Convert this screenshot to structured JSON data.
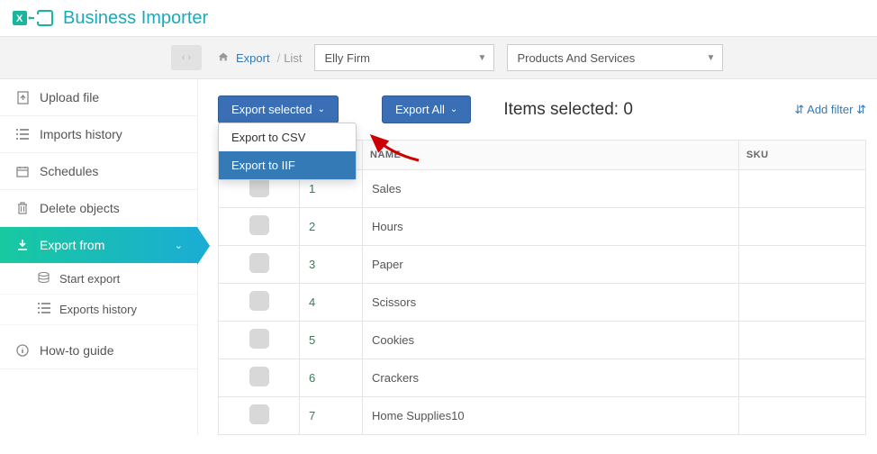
{
  "app": {
    "title": "Business Importer"
  },
  "toolbar": {
    "crumb_link": "Export",
    "crumb_current": "List",
    "select_firm": "Elly Firm",
    "select_entity": "Products And Services"
  },
  "sidebar": {
    "upload": "Upload file",
    "imports_history": "Imports history",
    "schedules": "Schedules",
    "delete_objects": "Delete objects",
    "export_from": "Export from",
    "start_export": "Start export",
    "exports_history": "Exports history",
    "howto": "How-to guide"
  },
  "actions": {
    "export_selected": "Export selected",
    "export_all": "Export All",
    "items_selected_label": "Items selected:",
    "items_selected_count": "0",
    "add_filter": "Add filter"
  },
  "dropdown": {
    "csv": "Export to CSV",
    "iif": "Export to IIF"
  },
  "table": {
    "headers": {
      "name": "NAME",
      "sku": "SKU"
    },
    "rows": [
      {
        "n": "1",
        "name": "Sales",
        "sku": ""
      },
      {
        "n": "2",
        "name": "Hours",
        "sku": ""
      },
      {
        "n": "3",
        "name": "Paper",
        "sku": ""
      },
      {
        "n": "4",
        "name": "Scissors",
        "sku": ""
      },
      {
        "n": "5",
        "name": "Cookies",
        "sku": ""
      },
      {
        "n": "6",
        "name": "Crackers",
        "sku": ""
      },
      {
        "n": "7",
        "name": "Home Supplies10",
        "sku": ""
      }
    ]
  }
}
